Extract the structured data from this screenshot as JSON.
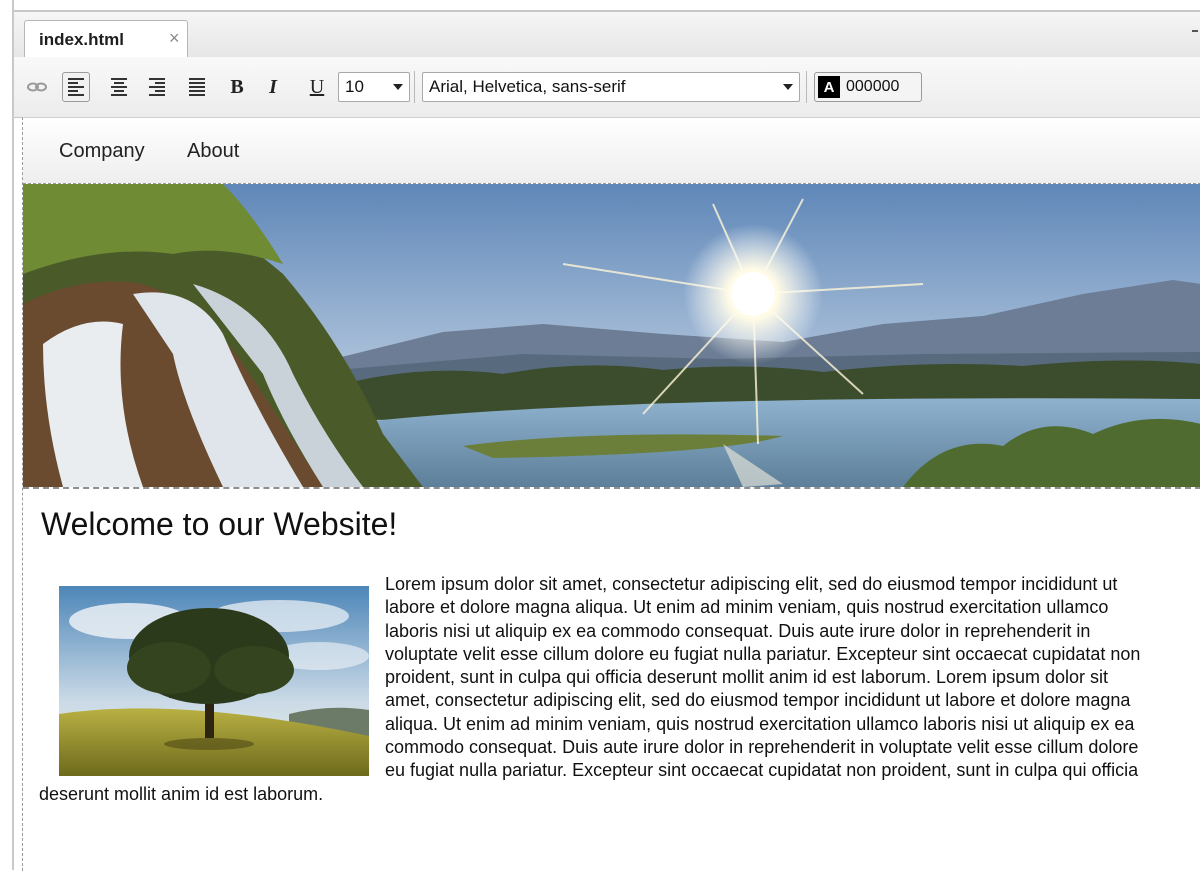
{
  "tab": {
    "label": "index.html",
    "close_glyph": "×"
  },
  "toolbar": {
    "link_icon": "link-icon",
    "align_icons": [
      "align-left-icon",
      "align-center-icon",
      "align-right-icon",
      "align-justify-icon"
    ],
    "bold": "B",
    "italic": "I",
    "underline": "U",
    "font_size": "10",
    "font_family": "Arial, Helvetica, sans-serif",
    "color_swatch_letter": "A",
    "color_hex": "000000"
  },
  "nav": {
    "items": [
      "Company",
      "About"
    ]
  },
  "hero": {
    "image": "landscape-waterfall-river-sunrise-image"
  },
  "main": {
    "heading": "Welcome to our Website!",
    "side_image": "tree-on-hill-image",
    "paragraph": "Lorem ipsum dolor sit amet, consectetur adipiscing elit, sed do eiusmod tempor incididunt ut labore et dolore magna aliqua. Ut enim ad minim veniam, quis nostrud exercitation ullamco laboris nisi ut aliquip ex ea commodo consequat. Duis aute irure dolor in reprehenderit in voluptate velit esse cillum dolore eu fugiat nulla pariatur. Excepteur sint occaecat cupidatat non proident, sunt in culpa qui officia deserunt mollit anim id est laborum. Lorem ipsum dolor sit amet, consectetur adipiscing elit, sed do eiusmod tempor incididunt ut labore et dolore magna aliqua. Ut enim ad minim veniam, quis nostrud exercitation ullamco laboris nisi ut aliquip ex ea commodo consequat. Duis aute irure dolor in reprehenderit in voluptate velit esse cillum dolore eu fugiat nulla pariatur. Excepteur sint occaecat cupidatat non proident, sunt in culpa qui officia deserunt mollit anim id est laborum."
  },
  "colors": {
    "accent_text": "#000000",
    "chrome": "#ececec"
  }
}
